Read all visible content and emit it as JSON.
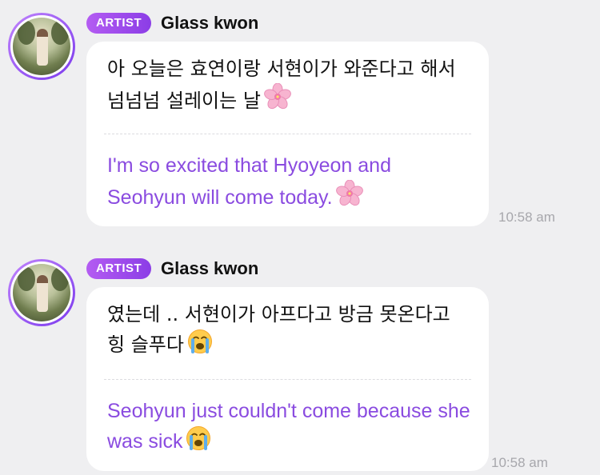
{
  "messages": [
    {
      "badge": "ARTIST",
      "sender": "Glass kwon",
      "korean": "아 오늘은 효연이랑 서현이가 와준다고 해서 넘넘넘 설레이는 날",
      "english": "I'm so excited that Hyoyeon and Seohyun will come today.",
      "emoji": "cherry-blossom-icon",
      "time": "10:58 am"
    },
    {
      "badge": "ARTIST",
      "sender": "Glass kwon",
      "korean": "였는데 .. 서현이가 아프다고 방금 못온다고 힝 슬푸다",
      "english": "Seohyun just couldn't come because she was sick",
      "emoji": "loudly-crying-face-icon",
      "time": "10:58 am"
    }
  ],
  "colors": {
    "background": "#efeff1",
    "bubble": "#ffffff",
    "translation": "#8a4be0",
    "badge": "#a14de9",
    "time": "#a7a7ac"
  }
}
